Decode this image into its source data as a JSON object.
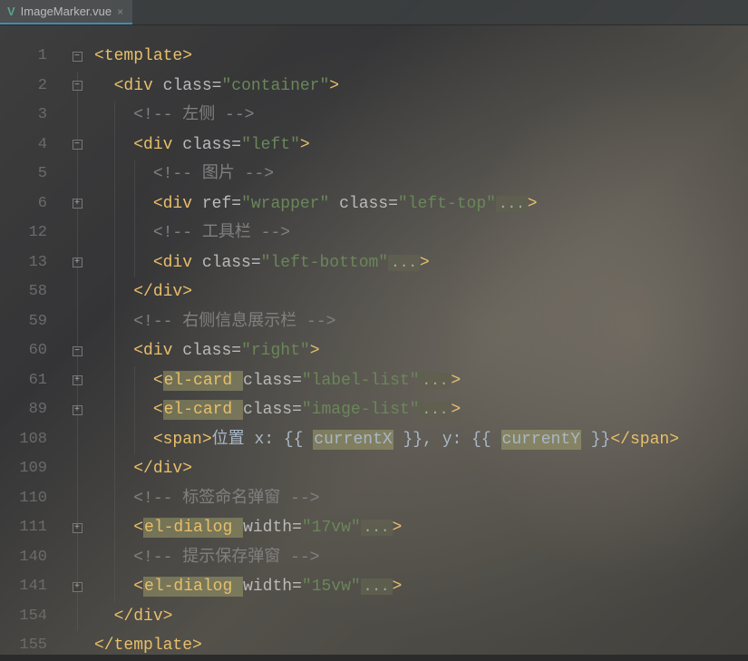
{
  "tab": {
    "filename": "ImageMarker.vue",
    "close": "×"
  },
  "gutter": [
    "1",
    "2",
    "3",
    "4",
    "5",
    "6",
    "12",
    "13",
    "58",
    "59",
    "60",
    "61",
    "89",
    "108",
    "109",
    "110",
    "111",
    "140",
    "141",
    "154",
    "155"
  ],
  "fold": [
    "minus",
    "minus",
    "",
    "minus",
    "",
    "plus",
    "",
    "plus",
    "",
    "",
    "minus",
    "plus",
    "plus",
    "",
    "",
    "",
    "plus",
    "",
    "plus",
    "",
    ""
  ],
  "code": {
    "l1": {
      "a": "<",
      "b": "template",
      "c": ">"
    },
    "l2": {
      "a": "<",
      "b": "div ",
      "c": "class",
      "d": "=",
      "e": "\"container\"",
      "f": ">"
    },
    "l3": {
      "open": "<!-- ",
      "body": "左侧 ",
      "close": "-->"
    },
    "l4": {
      "a": "<",
      "b": "div ",
      "c": "class",
      "d": "=",
      "e": "\"left\"",
      "f": ">"
    },
    "l5": {
      "open": "<!-- ",
      "body": "图片 ",
      "close": "-->"
    },
    "l6": {
      "a": "<",
      "b": "div ",
      "c1": "ref",
      "d": "=",
      "e1": "\"wrapper\" ",
      "c2": "class",
      "e2": "\"left-top\"",
      "fold": "...",
      "f": ">"
    },
    "l12": {
      "open": "<!-- ",
      "body": "工具栏 ",
      "close": "-->"
    },
    "l13": {
      "a": "<",
      "b": "div ",
      "c": "class",
      "d": "=",
      "e": "\"left-bottom\"",
      "fold": "...",
      "f": ">"
    },
    "l58": {
      "a": "</",
      "b": "div",
      "c": ">"
    },
    "l59": {
      "open": "<!-- ",
      "body": "右侧信息展示栏 ",
      "close": "-->"
    },
    "l60": {
      "a": "<",
      "b": "div ",
      "c": "class",
      "d": "=",
      "e": "\"right\"",
      "f": ">"
    },
    "l61": {
      "a": "<",
      "b": "el-card ",
      "c": "class",
      "d": "=",
      "e": "\"label-list\"",
      "fold": "...",
      "f": ">"
    },
    "l89": {
      "a": "<",
      "b": "el-card ",
      "c": "class",
      "d": "=",
      "e": "\"image-list\"",
      "fold": "...",
      "f": ">"
    },
    "l108": {
      "a": "<",
      "b": "span",
      "c": ">",
      "t1": "位置 x: ",
      "m1": "{{ ",
      "v1": "currentX",
      "m2": " }}",
      "t2": ", y: ",
      "m3": "{{ ",
      "v2": "currentY",
      "m4": " }}",
      "d": "</",
      "e": "span",
      "f": ">"
    },
    "l109": {
      "a": "</",
      "b": "div",
      "c": ">"
    },
    "l110": {
      "open": "<!-- ",
      "body": "标签命名弹窗 ",
      "close": "-->"
    },
    "l111": {
      "a": "<",
      "b": "el-dialog ",
      "c": "width",
      "d": "=",
      "e": "\"17vw\"",
      "fold": "...",
      "f": ">"
    },
    "l140": {
      "open": "<!-- ",
      "body": "提示保存弹窗 ",
      "close": "-->"
    },
    "l141": {
      "a": "<",
      "b": "el-dialog ",
      "c": "width",
      "d": "=",
      "e": "\"15vw\"",
      "fold": "...",
      "f": ">"
    },
    "l154": {
      "a": "</",
      "b": "div",
      "c": ">"
    },
    "l155": {
      "a": "</",
      "b": "template",
      "c": ">"
    }
  }
}
